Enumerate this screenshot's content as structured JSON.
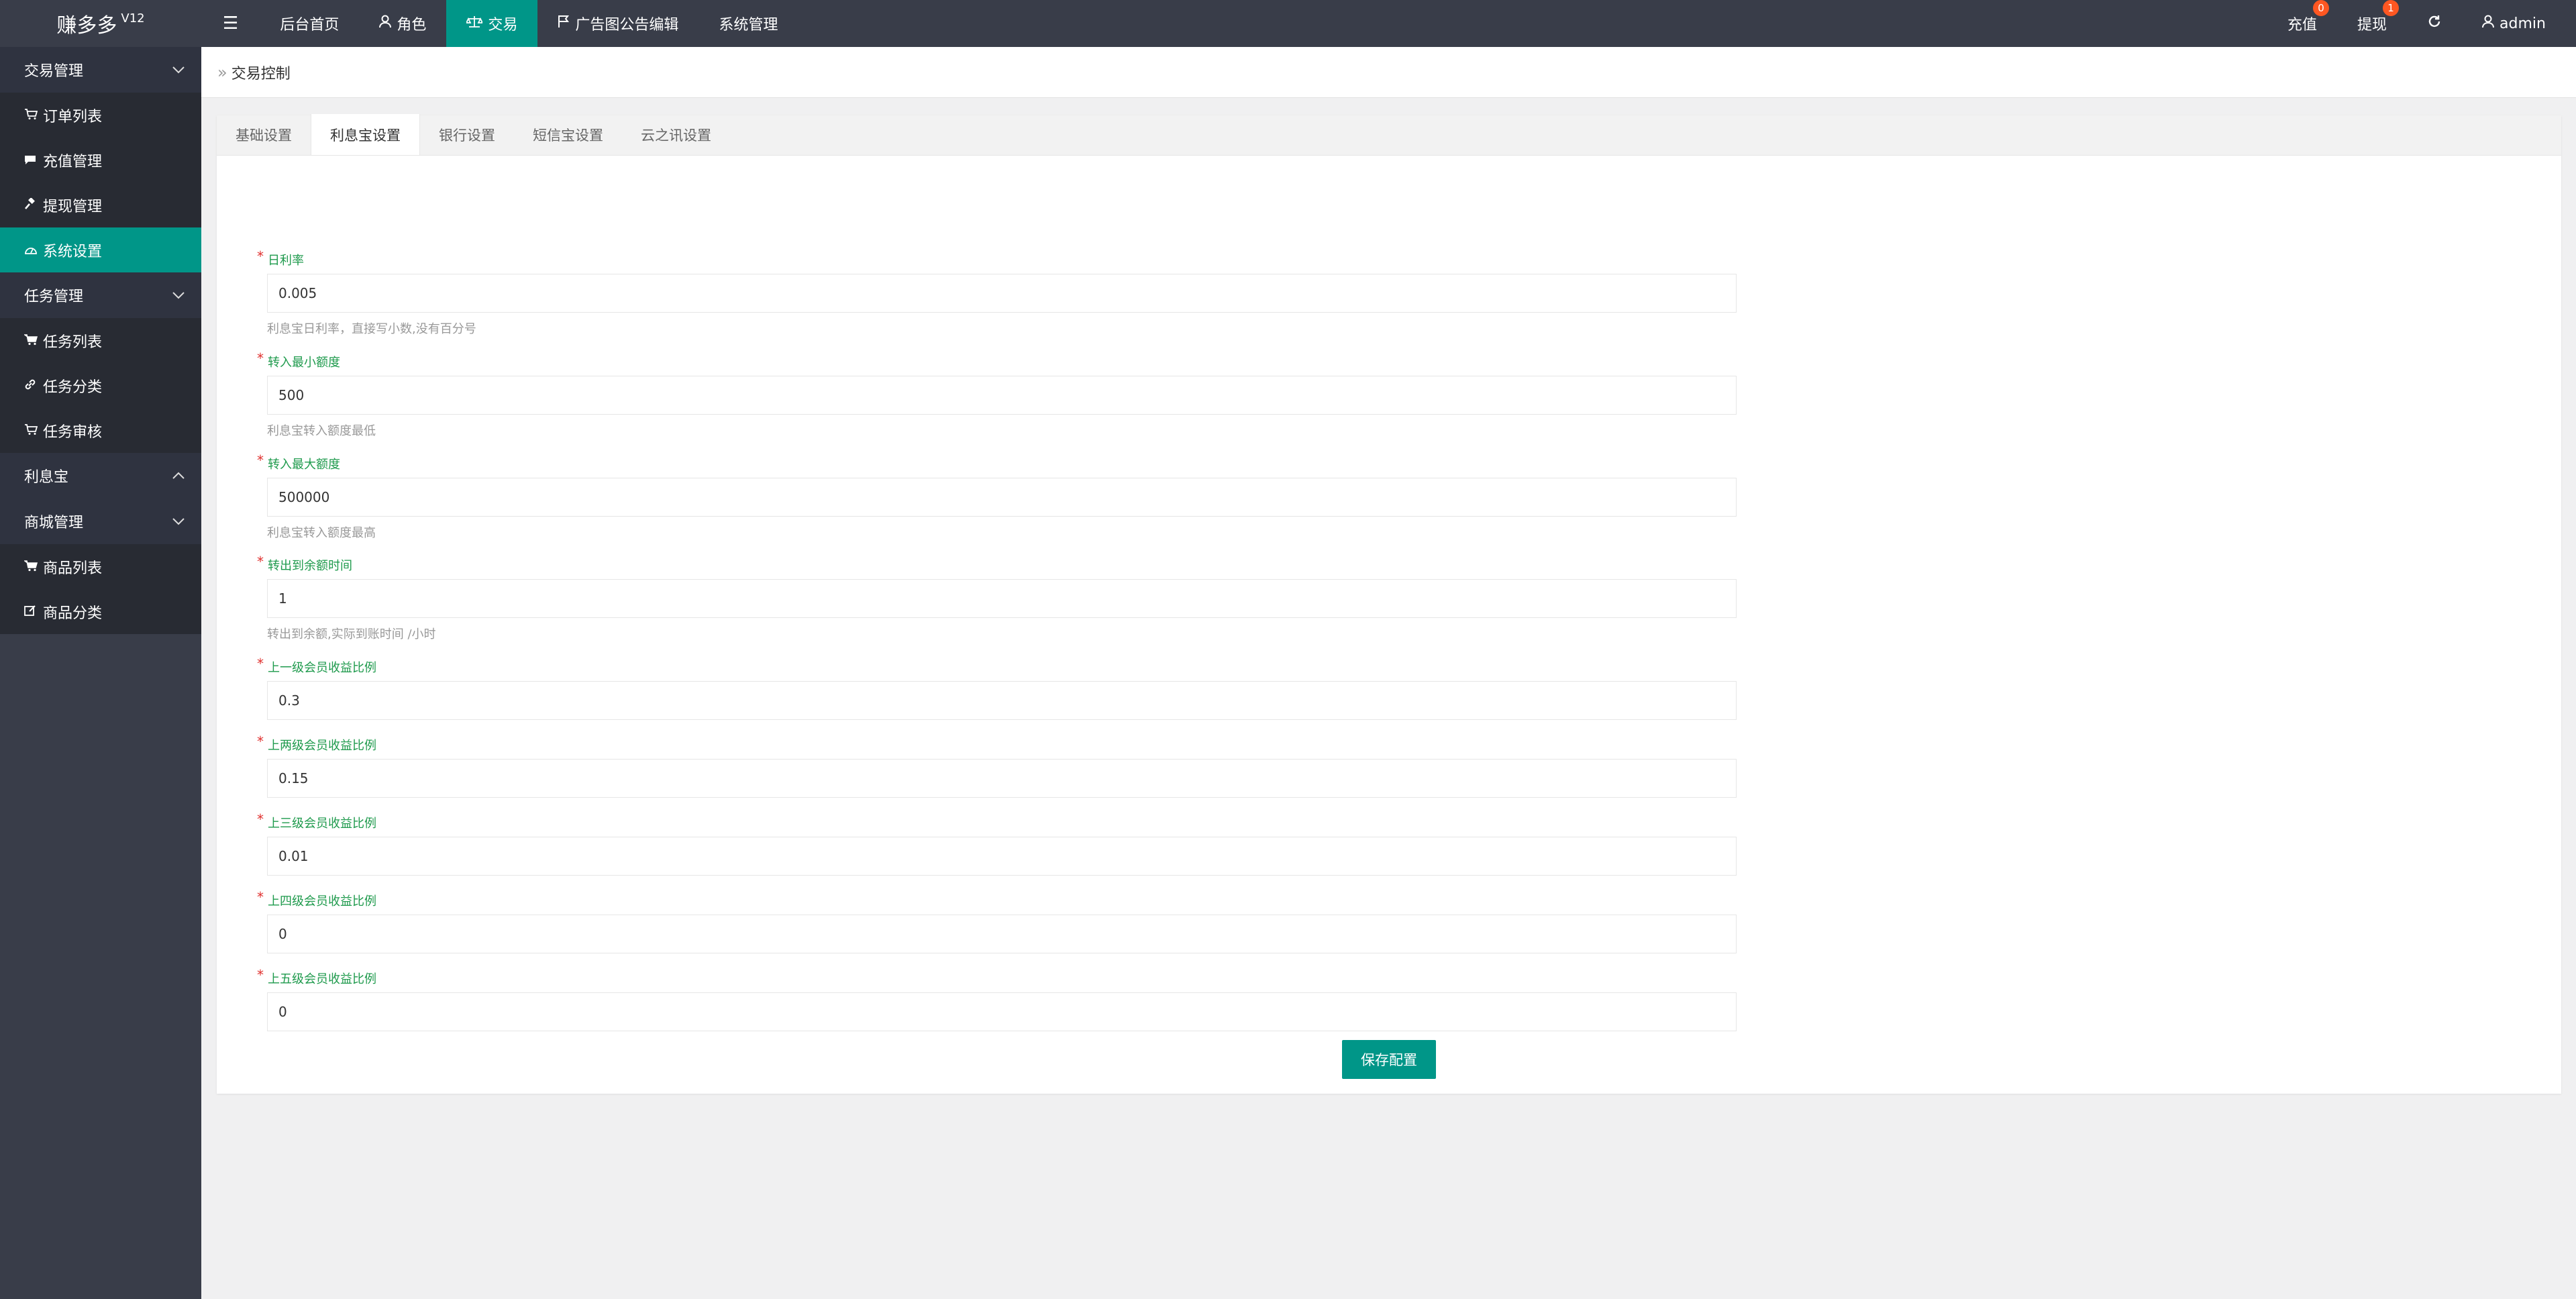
{
  "app": {
    "title": "赚多多",
    "version": "V12"
  },
  "topnav": {
    "items": [
      {
        "label": "后台首页"
      },
      {
        "label": "角色"
      },
      {
        "label": "交易"
      },
      {
        "label": "广告图公告编辑"
      },
      {
        "label": "系统管理"
      }
    ],
    "right": {
      "recharge": {
        "label": "充值",
        "badge": "0"
      },
      "withdraw": {
        "label": "提现",
        "badge": "1"
      },
      "user": "admin"
    }
  },
  "sidebar": {
    "groups": [
      {
        "title": "交易管理",
        "items": [
          "订单列表",
          "充值管理",
          "提现管理",
          "系统设置"
        ]
      },
      {
        "title": "任务管理",
        "items": [
          "任务列表",
          "任务分类",
          "任务审核"
        ]
      },
      {
        "title": "利息宝",
        "items": []
      },
      {
        "title": "商城管理",
        "items": [
          "商品列表",
          "商品分类"
        ]
      }
    ]
  },
  "breadcrumb": "交易控制",
  "tabs": [
    "基础设置",
    "利息宝设置",
    "银行设置",
    "短信宝设置",
    "云之讯设置"
  ],
  "form": {
    "fields": [
      {
        "label": "日利率",
        "value": "0.005",
        "hint": "利息宝日利率，直接写小数,没有百分号"
      },
      {
        "label": "转入最小额度",
        "value": "500",
        "hint": "利息宝转入额度最低"
      },
      {
        "label": "转入最大额度",
        "value": "500000",
        "hint": "利息宝转入额度最高"
      },
      {
        "label": "转出到余额时间",
        "value": "1",
        "hint": "转出到余额,实际到账时间 /小时"
      },
      {
        "label": "上一级会员收益比例",
        "value": "0.3"
      },
      {
        "label": "上两级会员收益比例",
        "value": "0.15"
      },
      {
        "label": "上三级会员收益比例",
        "value": "0.01"
      },
      {
        "label": "上四级会员收益比例",
        "value": "0"
      },
      {
        "label": "上五级会员收益比例",
        "value": "0"
      }
    ],
    "save_label": "保存配置"
  },
  "colors": {
    "accent": "#009688",
    "topbar": "#393d49",
    "label": "#1e9a4c",
    "required": "#e0312f",
    "badge": "#ff5722"
  }
}
